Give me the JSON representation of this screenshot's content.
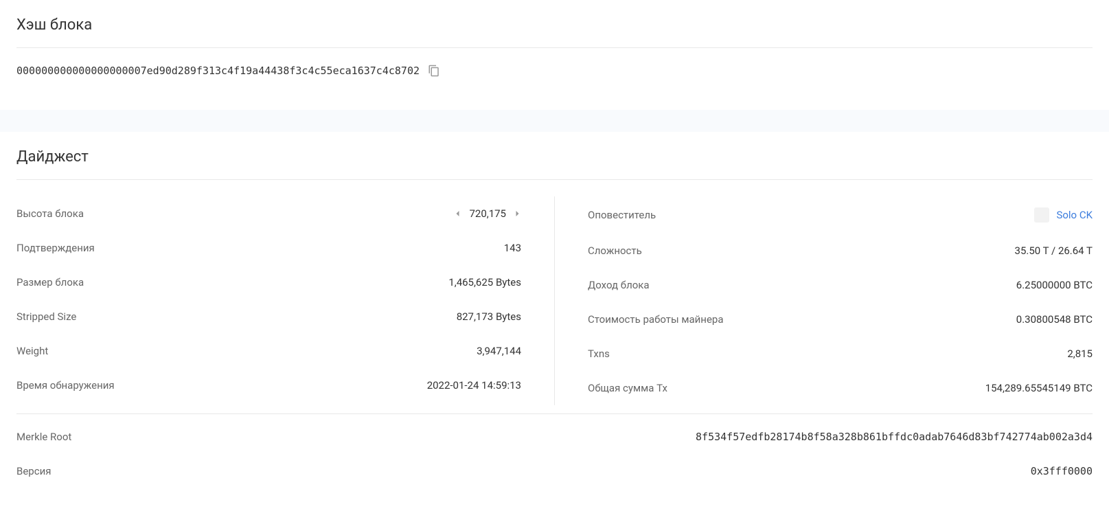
{
  "hash_section": {
    "title": "Хэш блока",
    "value": "000000000000000000007ed90d289f313c4f19a44438f3c4c55eca1637c4c8702"
  },
  "digest_section": {
    "title": "Дайджест",
    "left": {
      "height": {
        "label": "Высота блока",
        "value": "720,175"
      },
      "confirmations": {
        "label": "Подтверждения",
        "value": "143"
      },
      "block_size": {
        "label": "Размер блока",
        "value": "1,465,625 Bytes"
      },
      "stripped_size": {
        "label": "Stripped Size",
        "value": "827,173 Bytes"
      },
      "weight": {
        "label": "Weight",
        "value": "3,947,144"
      },
      "discovery_time": {
        "label": "Время обнаружения",
        "value": "2022-01-24 14:59:13"
      }
    },
    "right": {
      "relayed_by": {
        "label": "Оповеститель",
        "value": "Solo CK"
      },
      "difficulty": {
        "label": "Сложность",
        "value": "35.50 T / 26.64 T"
      },
      "block_reward": {
        "label": "Доход блока",
        "value": "6.25000000 BTC"
      },
      "fee_reward": {
        "label": "Стоимость работы майнера",
        "value": "0.30800548 BTC"
      },
      "txns": {
        "label": "Txns",
        "value": "2,815"
      },
      "total_tx": {
        "label": "Общая сумма Tx",
        "value": "154,289.65545149 BTC"
      }
    },
    "bottom": {
      "merkle_root": {
        "label": "Merkle Root",
        "value": "8f534f57edfb28174b8f58a328b861bffdc0adab7646d83bf742774ab002a3d4"
      },
      "version": {
        "label": "Версия",
        "value": "0x3fff0000"
      }
    }
  }
}
